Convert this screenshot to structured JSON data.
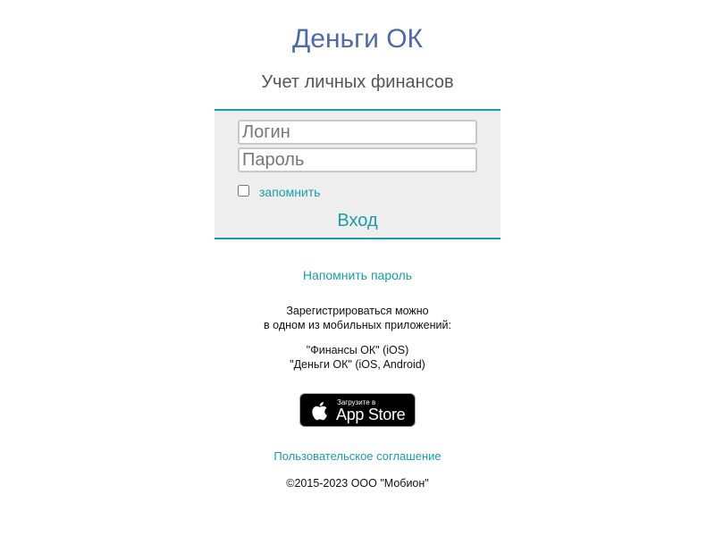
{
  "header": {
    "title": "Деньги ОК",
    "subtitle": "Учет личных финансов"
  },
  "login_form": {
    "login_placeholder": "Логин",
    "login_value": "",
    "password_placeholder": "Пароль",
    "password_value": "",
    "remember_label": "запомнить",
    "remember_checked": false,
    "submit_label": "Вход"
  },
  "links": {
    "remind_password": "Напомнить пароль",
    "user_agreement": "Пользовательское соглашение"
  },
  "register": {
    "line1": "Зарегистрироваться можно",
    "line2": "в одном из мобильных приложений:",
    "app1": "\"Финансы ОК\" (iOS)",
    "app2": "\"Деньги ОК\" (iOS, Android)"
  },
  "app_store_badge": {
    "small_text": "Загрузите в",
    "big_text": "App Store",
    "icon": "apple-icon"
  },
  "footer": {
    "copyright": "©2015-2023 ООО \"Мобион\""
  },
  "colors": {
    "accent": "#1a9ea8",
    "title": "#4d6aa8",
    "form_background": "#eeeeee"
  }
}
